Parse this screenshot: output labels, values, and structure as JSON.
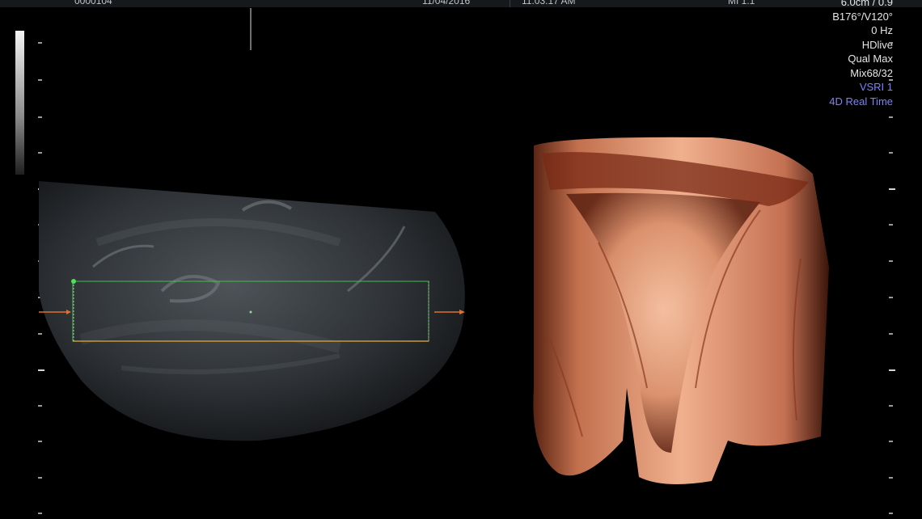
{
  "header": {
    "patient_id": "0000104",
    "date": "11/04/2016",
    "time": "11:03:17 AM",
    "mi": "MI  1.1"
  },
  "params": {
    "depth": "6.0cm / 0.9",
    "angles": "B176°/V120°",
    "frequency": "0 Hz",
    "render_mode": "HDlive",
    "quality": "Qual Max",
    "mix": "Mix68/32",
    "vsri": "VSRI 1",
    "mode": "4D Real Time"
  },
  "colors": {
    "accent_blue": "#7c82ff",
    "roi_box": "#3fbf4a",
    "roi_bottom": "#c49a3a",
    "arrow": "#e07030",
    "render_tissue": "#e6a07a"
  },
  "icons": {
    "left_arrow": "right-arrow-marker",
    "right_arrow": "right-arrow-marker",
    "roi_dot": "green-dot"
  }
}
